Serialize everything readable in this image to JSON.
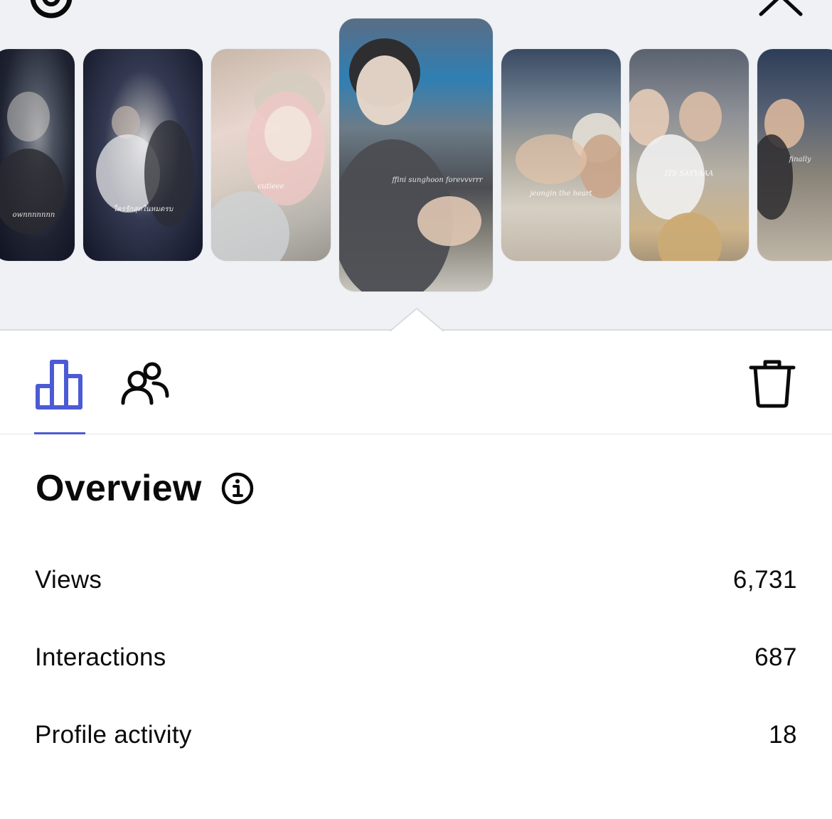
{
  "toolbar": {
    "settings_icon": "gear-icon",
    "close_icon": "close-icon"
  },
  "stories": [
    {
      "caption": "ownnnnnnn"
    },
    {
      "caption": "ใครรักสุดในหมดรบ"
    },
    {
      "caption": "cutieee"
    },
    {
      "caption": "ffini sunghoon forevvvrrr",
      "selected": true
    },
    {
      "caption": "jeongin the heart"
    },
    {
      "caption": "ITS SAYYAAA"
    },
    {
      "caption": "finally"
    }
  ],
  "tabs": {
    "stats_icon": "bar-chart-icon",
    "audience_icon": "people-icon",
    "delete_icon": "trash-icon",
    "active_color": "#4c5bd4"
  },
  "overview": {
    "title": "Overview",
    "info_icon": "info-icon",
    "metrics": [
      {
        "label": "Views",
        "value": "6,731"
      },
      {
        "label": "Interactions",
        "value": "687"
      },
      {
        "label": "Profile activity",
        "value": "18"
      }
    ]
  }
}
